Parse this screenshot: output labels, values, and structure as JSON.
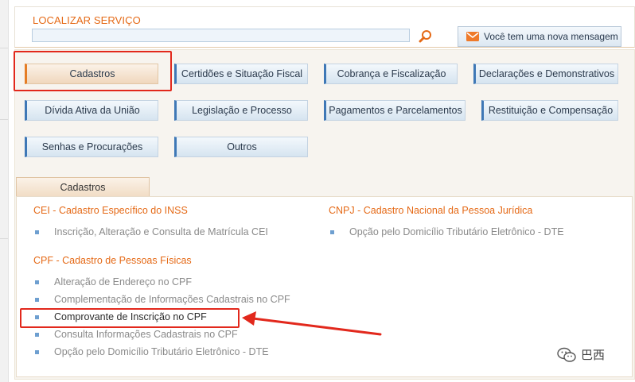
{
  "search": {
    "title": "LOCALIZAR SERVIÇO",
    "input_value": "",
    "message_button": "Você tem uma nova mensagem"
  },
  "categories": [
    {
      "label": "Cadastros",
      "active": true
    },
    {
      "label": "Certidões e Situação Fiscal",
      "active": false
    },
    {
      "label": "Cobrança e Fiscalização",
      "active": false
    },
    {
      "label": "Declarações e Demonstrativos",
      "active": false
    },
    {
      "label": "Dívida Ativa da União",
      "active": false
    },
    {
      "label": "Legislação e Processo",
      "active": false
    },
    {
      "label": "Pagamentos e Parcelamentos",
      "active": false
    },
    {
      "label": "Restituição e Compensação",
      "active": false
    },
    {
      "label": "Senhas e Procurações",
      "active": false
    },
    {
      "label": "Outros",
      "active": false
    }
  ],
  "tab": {
    "label": "Cadastros"
  },
  "sections": {
    "cei": {
      "title": "CEI - Cadastro Específico do INSS",
      "items": [
        "Inscrição, Alteração e Consulta de Matrícula CEI"
      ]
    },
    "cnpj": {
      "title": "CNPJ - Cadastro Nacional da Pessoa Jurídica",
      "items": [
        "Opção pelo Domicílio Tributário Eletrônico - DTE"
      ]
    },
    "cpf": {
      "title": "CPF - Cadastro de Pessoas Físicas",
      "items": [
        "Alteração de Endereço no CPF",
        "Complementação de Informações Cadastrais no CPF",
        "Comprovante de Inscrição no CPF",
        "Consulta Informações Cadastrais no CPF",
        "Opção pelo Domicílio Tributário Eletrônico - DTE"
      ]
    }
  },
  "watermark": {
    "text": "巴西"
  },
  "colors": {
    "accent": "#e56a17",
    "highlight": "#e2281c",
    "bullet": "#6e9fd0"
  }
}
